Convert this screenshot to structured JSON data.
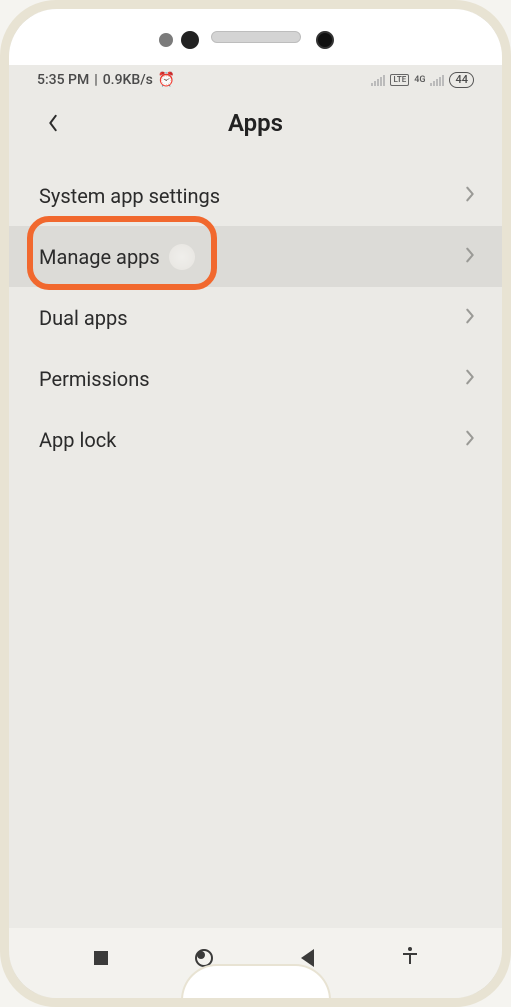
{
  "status": {
    "time": "5:35 PM",
    "net_speed": "0.9KB/s",
    "alarm_icon": "⏰",
    "lte_label": "LTE",
    "net_label": "4G",
    "battery": "44"
  },
  "header": {
    "title": "Apps"
  },
  "list": {
    "items": [
      {
        "label": "System app settings"
      },
      {
        "label": "Manage apps"
      },
      {
        "label": "Dual apps"
      },
      {
        "label": "Permissions"
      },
      {
        "label": "App lock"
      }
    ]
  },
  "annotation": {
    "highlighted_item_index": 1
  }
}
